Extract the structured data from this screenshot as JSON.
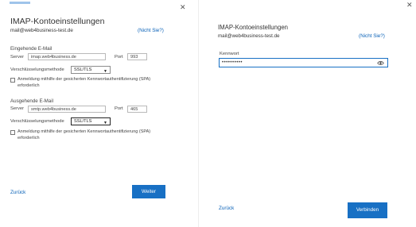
{
  "left": {
    "title": "IMAP-Kontoeinstellungen",
    "email": "mail@web4business-test.de",
    "not_you": "(Nicht Sie?)",
    "incoming": {
      "heading": "Eingehende E-Mail",
      "server_label": "Server",
      "server_value": "imap.web4business.de",
      "port_label": "Port",
      "port_value": "993",
      "encryption_label": "Verschlüsselungsmethode",
      "encryption_value": "SSL/TLS",
      "spa_text": "Anmeldung mithilfe der gesicherten Kennwortauthentifizierung (SPA) erforderlich"
    },
    "outgoing": {
      "heading": "Ausgehende E-Mail",
      "server_label": "Server",
      "server_value": "smtp.web4business.de",
      "port_label": "Port",
      "port_value": "465",
      "encryption_label": "Verschlüsselungsmethode",
      "encryption_value": "SSL/TLS",
      "spa_text": "Anmeldung mithilfe der gesicherten Kennwortauthentifizierung (SPA) erforderlich"
    },
    "back_label": "Zurück",
    "next_label": "Weiter"
  },
  "right": {
    "title": "IMAP-Kontoeinstellungen",
    "email": "mail@web4business-test.de",
    "not_you": "(Nicht Sie?)",
    "password_label": "Kennwort",
    "password_value": "••••••••••",
    "back_label": "Zurück",
    "connect_label": "Verbinden"
  },
  "colors": {
    "accent": "#1870c4",
    "link": "#0a62b8"
  },
  "icons": {
    "close": "close-icon",
    "reveal": "eye-icon",
    "dropdown": "chevron-down-icon"
  }
}
